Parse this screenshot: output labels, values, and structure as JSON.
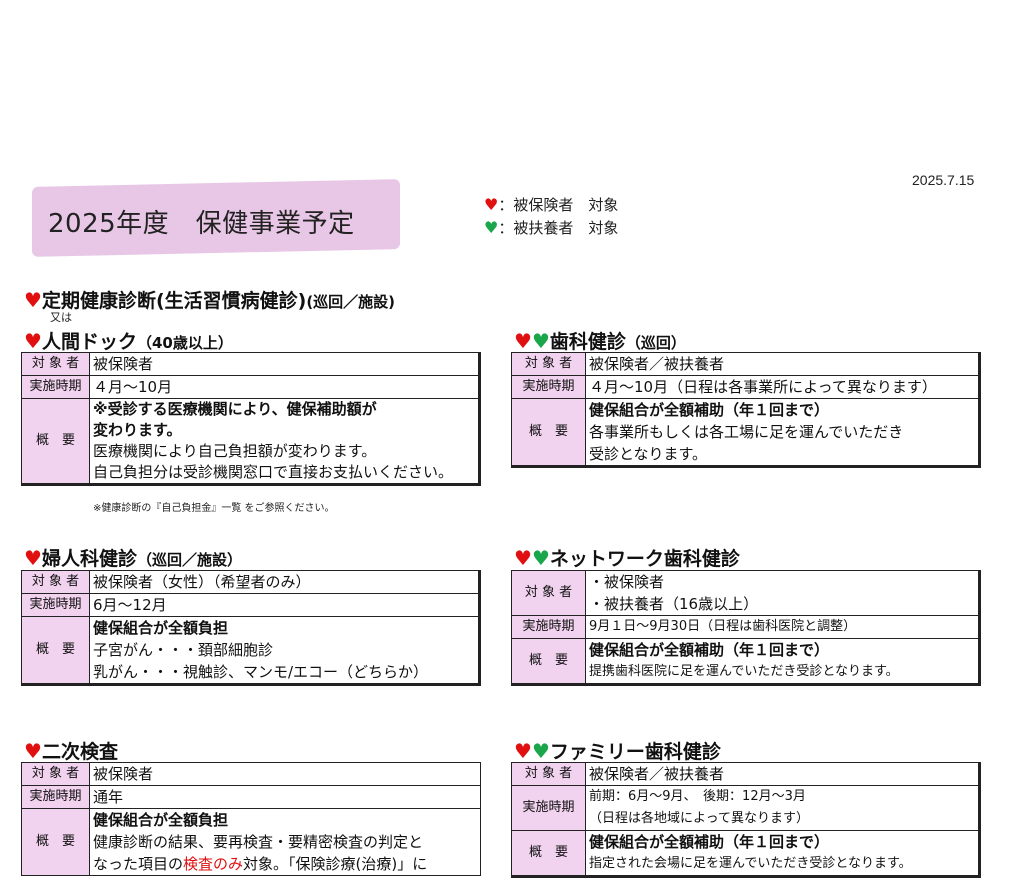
{
  "date": "2025.7.15",
  "title": "2025年度　保健事業予定",
  "legend": {
    "red": "：被保険者　対象",
    "green": "：被扶養者　対象"
  },
  "colors": {
    "banner": "#e8c7e6",
    "label_bg": "#f1d2ef",
    "heart_red": "#e01010",
    "heart_green": "#1aa64a"
  },
  "labels": {
    "target": "対 象 者",
    "period": "実施時期",
    "summary": "概　要"
  },
  "teiki": {
    "heading": "定期健康診断(生活習慣病健診)",
    "sub": "(巡回／施設)",
    "or": "又は"
  },
  "ningen": {
    "heading": "人間ドック",
    "sub": "（40歳以上）",
    "target": "被保険者",
    "period": "４月～10月",
    "summary1": "※受診する医療機関により、健保補助額が",
    "summary2": "変わります。",
    "summary3": "医療機関により自己負担額が変わります。",
    "summary4": "自己負担分は受診機関窓口で直接お支払いください。",
    "note": "※健康診断の『自己負担金』一覧 をご参照ください。"
  },
  "shika": {
    "heading": "歯科健診",
    "sub": "（巡回）",
    "target": "被保険者／被扶養者",
    "period": "４月～10月（日程は各事業所によって異なります）",
    "summary1": "健保組合が全額補助（年１回まで）",
    "summary2": "各事業所もしくは各工場に足を運んでいただき",
    "summary3": "受診となります。"
  },
  "fujinka": {
    "heading": "婦人科健診",
    "sub": "（巡回／施設）",
    "target": "被保険者（女性）（希望者のみ）",
    "period": "6月～12月",
    "summary1": "健保組合が全額負担",
    "summary2": "子宮がん・・・頚部細胞診",
    "summary3": "乳がん・・・視触診、マンモ/エコー（どちらか）"
  },
  "network": {
    "heading": "ネットワーク歯科健診",
    "target1": "・被保険者",
    "target2": "・被扶養者（16歳以上）",
    "period": "9月１日～9月30日（日程は歯科医院と調整）",
    "summary1": "健保組合が全額補助（年１回まで）",
    "summary2": "提携歯科医院に足を運んでいただき受診となります。"
  },
  "niji": {
    "heading": "二次検査",
    "target": "被保険者",
    "period": "通年",
    "summary1": "健保組合が全額負担",
    "summary2": "健康診断の結果、要再検査・要精密検査の判定と",
    "summary3a": "なった項目の",
    "summary3b": "検査のみ",
    "summary3c": "対象。「保険診療(治療)」に"
  },
  "family": {
    "heading": "ファミリー歯科健診",
    "target": "被保険者／被扶養者",
    "period1": "前期：6月～9月、　後期：12月～3月",
    "period2": "（日程は各地域によって異なります）",
    "summary1": "健保組合が全額補助（年１回まで）",
    "summary2": "指定された会場に足を運んでいただき受診となります。"
  }
}
